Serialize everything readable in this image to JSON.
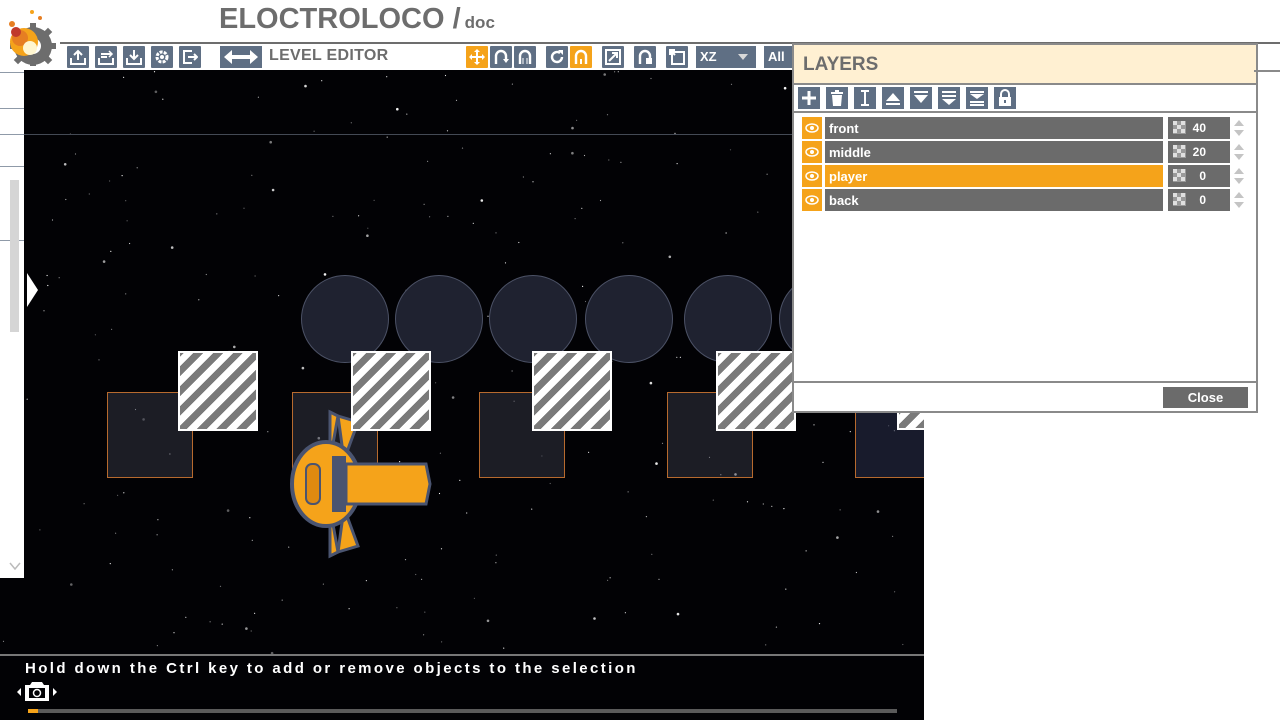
{
  "app": {
    "title": "ELOCTROLOCO /",
    "subtitle": "doc",
    "accent": "#f5a31a",
    "button_color": "#5f6f84"
  },
  "toolbar": {
    "left_icons": [
      "export-icon",
      "import-icon",
      "download-icon",
      "gear-icon",
      "exit-icon"
    ],
    "mode_label": "LEVEL EDITOR",
    "tool_icons": [
      "move-icon",
      "rotate-icon",
      "grid-icon",
      "refresh-icon",
      "magnet-icon",
      "resize-icon",
      "snap-icon",
      "flip-icon"
    ],
    "axis_select": "XZ",
    "select_all": "All"
  },
  "viewport": {
    "hint": "Hold down the Ctrl key to add or remove objects to the selection",
    "progress": 0.012
  },
  "layers_dialog": {
    "title": "LAYERS",
    "toolbar_icons": [
      "add-icon",
      "delete-icon",
      "rename-icon",
      "move-up-icon",
      "move-down-icon",
      "merge-down-icon",
      "merge-all-icon",
      "lock-icon"
    ],
    "layers": [
      {
        "name": "front",
        "depth": "40",
        "selected": false
      },
      {
        "name": "middle",
        "depth": "20",
        "selected": false
      },
      {
        "name": "player",
        "depth": "0",
        "selected": true
      },
      {
        "name": "back",
        "depth": "0",
        "selected": false
      }
    ],
    "close_label": "Close"
  }
}
